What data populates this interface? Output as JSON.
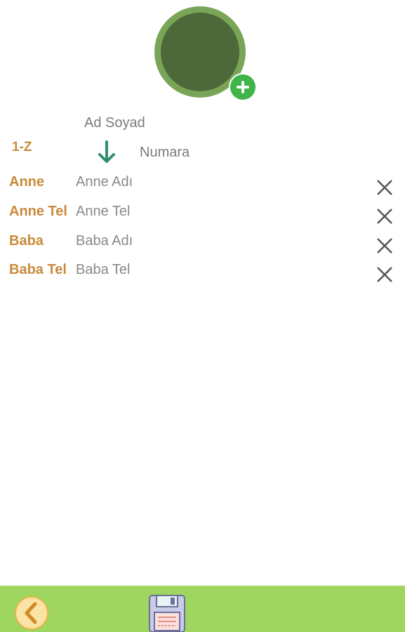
{
  "profile": {
    "name_placeholder": "Ad Soyad",
    "number_placeholder": "Numara",
    "group": "1-Z"
  },
  "fields": [
    {
      "label": "Anne",
      "placeholder": "Anne Adı"
    },
    {
      "label": "Anne Tel",
      "placeholder": "Anne Tel"
    },
    {
      "label": "Baba",
      "placeholder": "Baba Adı"
    },
    {
      "label": "Baba Tel",
      "placeholder": "Baba Tel"
    }
  ],
  "colors": {
    "accent_green": "#9ed660",
    "label_orange": "#c98a3c",
    "avatar_dark": "#4e6939",
    "add_button": "#3fb449"
  }
}
